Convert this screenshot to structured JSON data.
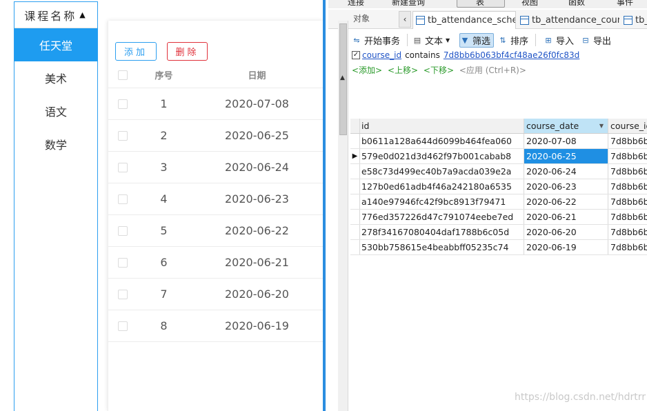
{
  "left_app": {
    "course_header": "课程名称",
    "courses": [
      {
        "label": "任天堂",
        "active": true
      },
      {
        "label": "美术",
        "active": false
      },
      {
        "label": "语文",
        "active": false
      },
      {
        "label": "数学",
        "active": false
      }
    ],
    "add_label": "添加",
    "delete_label": "删除",
    "table_headers": {
      "seq": "序号",
      "date": "日期"
    },
    "rows": [
      {
        "seq": "1",
        "date": "2020-07-08"
      },
      {
        "seq": "2",
        "date": "2020-06-25"
      },
      {
        "seq": "3",
        "date": "2020-06-24"
      },
      {
        "seq": "4",
        "date": "2020-06-23"
      },
      {
        "seq": "5",
        "date": "2020-06-22"
      },
      {
        "seq": "6",
        "date": "2020-06-21"
      },
      {
        "seq": "7",
        "date": "2020-06-20"
      },
      {
        "seq": "8",
        "date": "2020-06-19"
      }
    ]
  },
  "db_tool": {
    "menu": [
      "连接",
      "新建查询",
      "表",
      "视图",
      "函数",
      "事件"
    ],
    "objects_tab": "对象",
    "tabs": [
      "tb_attendance_sche...",
      "tb_attendance_cour...",
      "tb_"
    ],
    "toolbar": {
      "begin_txn": "开始事务",
      "text": "文本",
      "filter": "筛选",
      "sort": "排序",
      "import": "导入",
      "export": "导出"
    },
    "filter": {
      "field": "course_id",
      "operator": "contains",
      "value": "7d8bb6b063bf4cf48ae26f0fc83d"
    },
    "filter_actions": {
      "add": "<添加>",
      "up": "<上移>",
      "down": "<下移>",
      "apply": "<应用 (Ctrl+R)>"
    },
    "columns": [
      "id",
      "course_date",
      "course_id"
    ],
    "rows": [
      {
        "id": "b0611a128a644d6099b464fea060",
        "course_date": "2020-07-08",
        "course_id": "7d8bb6b"
      },
      {
        "id": "579e0d021d3d462f97b001cabab8",
        "course_date": "2020-06-25",
        "course_id": "7d8bb6b"
      },
      {
        "id": "e58c73d499ec40b7a9acda039e2a",
        "course_date": "2020-06-24",
        "course_id": "7d8bb6b"
      },
      {
        "id": "127b0ed61adb4f46a242180a6535",
        "course_date": "2020-06-23",
        "course_id": "7d8bb6b"
      },
      {
        "id": "a140e97946fc42f9bc8913f79471",
        "course_date": "2020-06-22",
        "course_id": "7d8bb6b"
      },
      {
        "id": "776ed357226d47c791074eebe7ed",
        "course_date": "2020-06-21",
        "course_id": "7d8bb6b"
      },
      {
        "id": "278f34167080404daf1788b6c05d",
        "course_date": "2020-06-20",
        "course_id": "7d8bb6b"
      },
      {
        "id": "530bb758615e4beabbff05235c74",
        "course_date": "2020-06-19",
        "course_id": "7d8bb6b"
      }
    ],
    "selected_row": 1
  },
  "watermark": "https://blog.csdn.net/hdrtrr"
}
